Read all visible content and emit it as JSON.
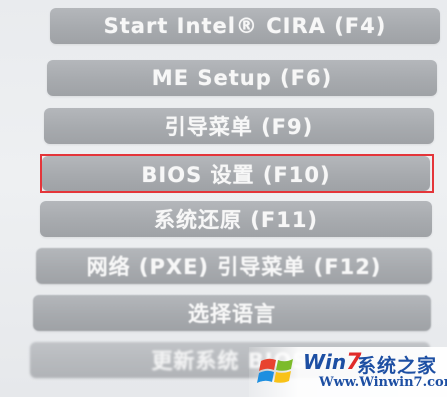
{
  "menu": {
    "items": [
      {
        "label": "Start Intel® CIRA (F4)"
      },
      {
        "label": "ME Setup (F6)"
      },
      {
        "label": "引导菜单 (F9)"
      },
      {
        "label": "BIOS 设置 (F10)"
      },
      {
        "label": "系统还原 (F11)"
      },
      {
        "label": "网络 (PXE) 引导菜单 (F12)"
      },
      {
        "label": "选择语言"
      },
      {
        "label": "更新系统 BIOS"
      }
    ],
    "highlighted_item": "BIOS 设置 (F10)",
    "highlight_color": "#e4353a",
    "button_color": "#a9acb0",
    "text_color": "#f7f7f7"
  },
  "watermark": {
    "brand_prefix": "Win",
    "brand_number": "7",
    "brand_cn": "系统之家",
    "url": "Www.Winwin7.com",
    "brand_color": "#1d4fa3",
    "accent_color": "#e02a2a",
    "icon": "windows-logo-icon"
  }
}
